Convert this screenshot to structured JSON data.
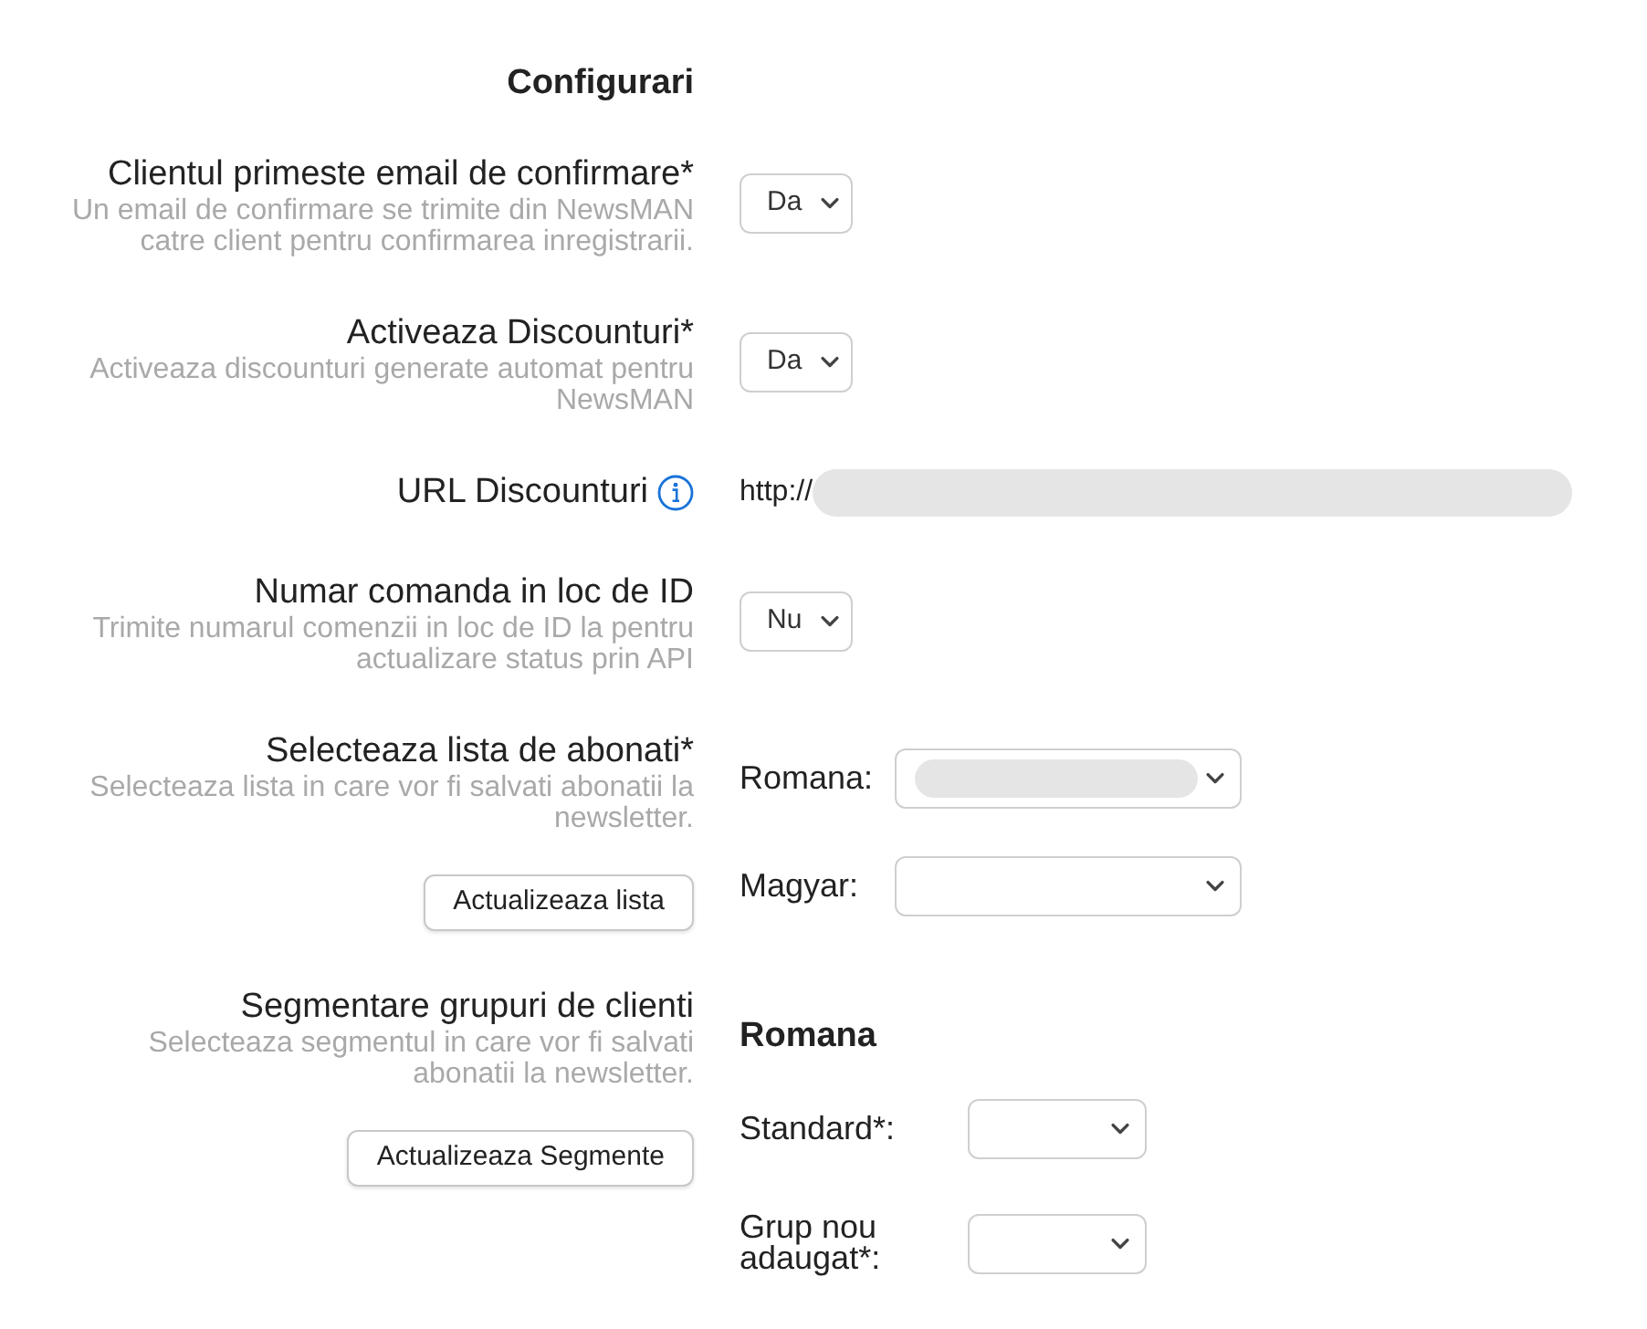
{
  "section_title": "Configurari",
  "settings": [
    {
      "kind": "select",
      "label": "Clientul primeste email de confirmare*",
      "description": "Un email de confirmare se trimite din NewsMAN catre client pentru confirmarea inregistrarii.",
      "value": "Da"
    },
    {
      "kind": "select",
      "label": "Activeaza Discounturi*",
      "description": "Activeaza discounturi generate automat pentru NewsMAN",
      "value": "Da"
    },
    {
      "kind": "url",
      "label": "URL Discounturi",
      "info": true,
      "value": "http://",
      "redacted": true
    },
    {
      "kind": "select",
      "label": "Numar comanda in loc de ID",
      "description": "Trimite numarul comenzii in loc de ID la pentru actualizare status prin API",
      "value": "Nu"
    },
    {
      "kind": "lists",
      "label": "Selecteaza lista de abonati*",
      "description": "Selecteaza lista in care vor fi salvati abonatii la newsletter.",
      "button": "Actualizeaza lista",
      "fields": [
        {
          "label": "Romana:",
          "redacted": true
        },
        {
          "label": "Magyar:",
          "redacted": false
        }
      ]
    },
    {
      "kind": "segments",
      "label": "Segmentare grupuri de clienti",
      "description": "Selecteaza segmentul in care vor fi salvati abonatii la newsletter.",
      "button": "Actualizeaza Segmente",
      "group_title": "Romana",
      "fields": [
        {
          "label": "Standard*:"
        },
        {
          "label": "Grup nou adaugat*:"
        }
      ]
    }
  ]
}
